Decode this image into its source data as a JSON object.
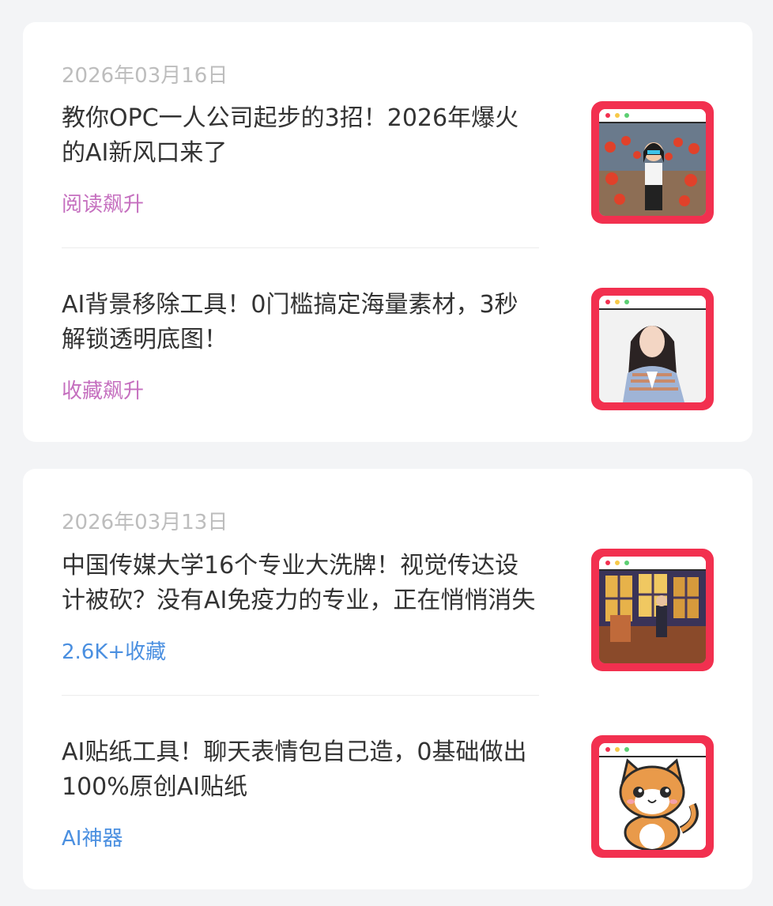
{
  "groups": [
    {
      "date": "2026年03月16日",
      "items": [
        {
          "title": "教你OPC一人公司起步的3招！2026年爆火的AI新风口来了",
          "tag": "阅读飙升",
          "thumbnail_icon": "office-woman-illustration"
        },
        {
          "title": "AI背景移除工具！0门槛搞定海量素材，3秒解锁透明底图！",
          "tag": "收藏飙升",
          "thumbnail_icon": "portrait-woman-cutout"
        }
      ]
    },
    {
      "date": "2026年03月13日",
      "items": [
        {
          "title": "中国传媒大学16个专业大洗牌！视觉传达设计被砍？没有AI免疫力的专业，正在悄悄消失",
          "tag": "2.6K+收藏",
          "thumbnail_icon": "art-studio-painting"
        },
        {
          "title": "AI贴纸工具！聊天表情包自己造，0基础做出100%原创AI贴纸",
          "tag": "AI神器",
          "thumbnail_icon": "cartoon-cat-sticker"
        }
      ]
    }
  ],
  "colors": {
    "background": "#f3f4f6",
    "card": "#ffffff",
    "date": "#bdbdbd",
    "title": "#333333",
    "tag_pink": "#c56fbf",
    "tag_blue": "#4a8fe0",
    "thumb_frame": "#f2304f"
  }
}
